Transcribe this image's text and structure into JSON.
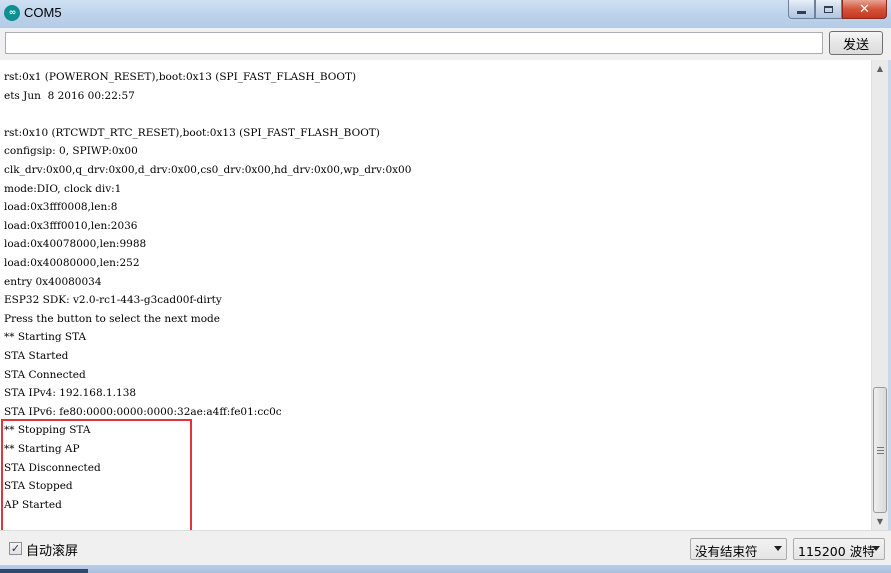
{
  "window": {
    "title": "COM5",
    "app_icon": "arduino-infinity-icon",
    "app_icon_glyph": "∞",
    "controls": [
      "minimize-icon",
      "maximize-icon",
      "close-icon"
    ]
  },
  "send": {
    "input_value": "",
    "button_label": "发送"
  },
  "console": {
    "lines": [
      "rst:0x1 (POWERON_RESET),boot:0x13 (SPI_FAST_FLASH_BOOT)",
      "ets Jun  8 2016 00:22:57",
      "",
      "rst:0x10 (RTCWDT_RTC_RESET),boot:0x13 (SPI_FAST_FLASH_BOOT)",
      "configsip: 0, SPIWP:0x00",
      "clk_drv:0x00,q_drv:0x00,d_drv:0x00,cs0_drv:0x00,hd_drv:0x00,wp_drv:0x00",
      "mode:DIO, clock div:1",
      "load:0x3fff0008,len:8",
      "load:0x3fff0010,len:2036",
      "load:0x40078000,len:9988",
      "load:0x40080000,len:252",
      "entry 0x40080034",
      "ESP32 SDK: v2.0-rc1-443-g3cad00f-dirty",
      "Press the button to select the next mode",
      "** Starting STA",
      "STA Started",
      "STA Connected",
      "STA IPv4: 192.168.1.138",
      "STA IPv6: fe80:0000:0000:0000:32ae:a4ff:fe01:cc0c",
      "** Stopping STA",
      "** Starting AP",
      "STA Disconnected",
      "STA Stopped",
      "AP Started"
    ],
    "highlight_color": "#e0343d"
  },
  "footer": {
    "autoscroll_label": "自动滚屏",
    "autoscroll_checked": true,
    "line_ending_selected": "没有结束符",
    "baud_selected": "115200 波特"
  }
}
